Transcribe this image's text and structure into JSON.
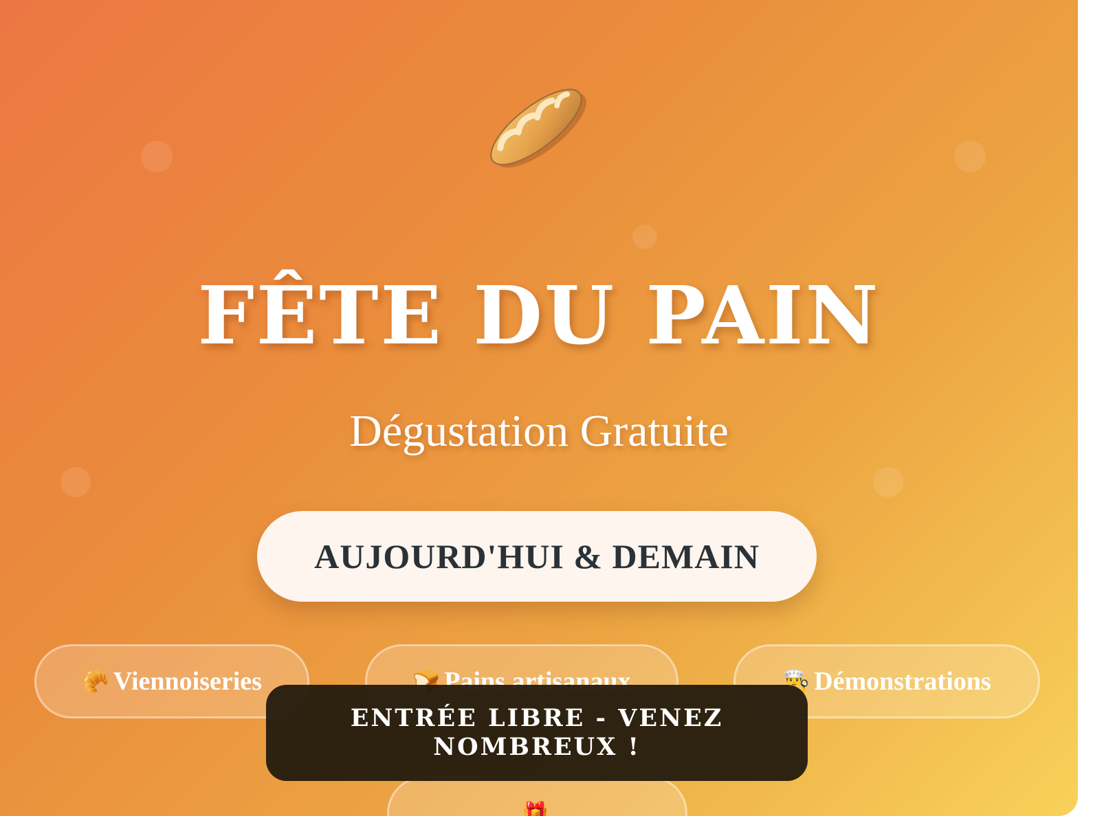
{
  "poster": {
    "title": "FÊTE DU PAIN",
    "subtitle": "Dégustation Gratuite",
    "date_label": "AUJOURD'HUI & DEMAIN",
    "hero_icon": "baguette-icon",
    "features": [
      {
        "icon": "croissant-icon",
        "emoji": "🥐",
        "label": "Viennoiseries"
      },
      {
        "icon": "bread-loaf-icon",
        "emoji": "🍞",
        "label": "Pains artisanaux"
      },
      {
        "icon": "chef-icon",
        "emoji": "👨‍🍳",
        "label": "Démonstrations"
      },
      {
        "icon": "gift-icon",
        "emoji": "🎁",
        "label": ""
      }
    ],
    "banner": "ENTRÉE LIBRE - VENEZ NOMBREUX !"
  },
  "colors": {
    "gradient_start": "#ec7643",
    "gradient_end": "#f8d15a",
    "pill_background": "#fdf5ee",
    "pill_text": "#2a3238",
    "banner_background": "#231a0e"
  }
}
